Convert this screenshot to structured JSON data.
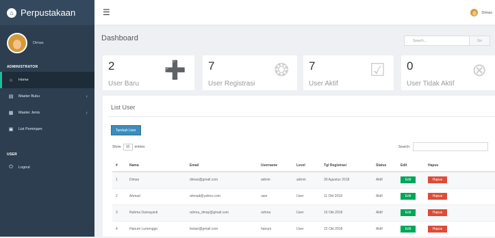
{
  "sidebar": {
    "brand": "Perpustakaan",
    "user_name": "Dimas",
    "section_admin": "ADMINISTRATOR",
    "section_user": "USER",
    "items": [
      {
        "label": "Home",
        "icon": "home-icon"
      },
      {
        "label": "Master Buku",
        "icon": "book-icon"
      },
      {
        "label": "Master Jenis",
        "icon": "list-icon"
      },
      {
        "label": "List Peminjam",
        "icon": "users-icon"
      },
      {
        "label": "Logout",
        "icon": "logout-icon"
      }
    ]
  },
  "topbar": {
    "menu_icon": "☰",
    "username": "Dimas"
  },
  "page": {
    "title": "Dashboard",
    "search_placeholder": "Search...",
    "search_button": "Go"
  },
  "stats": [
    {
      "value": "2",
      "label": "User Baru",
      "icon": "user-plus-icon",
      "glyph": "👤"
    },
    {
      "value": "7",
      "label": "User Registrasi",
      "icon": "users-icon",
      "glyph": "👥"
    },
    {
      "value": "7",
      "label": "User Aktif",
      "icon": "check-square-icon",
      "glyph": "☑"
    },
    {
      "value": "0",
      "label": "User Tidak Aktif",
      "icon": "times-circle-icon",
      "glyph": "⊗"
    }
  ],
  "panel": {
    "title": "List User",
    "add_button": "Tambah User",
    "show_prefix": "Show",
    "show_value": "10",
    "show_suffix": "entries",
    "search_label": "Search:"
  },
  "table": {
    "headers": [
      "#",
      "Nama",
      "Email",
      "Username",
      "Level",
      "Tgl Registrasi",
      "Status",
      "Edit",
      "Hapus"
    ],
    "rows": [
      {
        "no": "1",
        "nama": "Dimas",
        "email": "dimas@gmail.com",
        "username": "admin",
        "level": "admin",
        "tgl": "30 Agustus 2018",
        "status": "Aktif"
      },
      {
        "no": "2",
        "nama": "Ahmad",
        "email": "ahmad@yahoo.com",
        "username": "user",
        "level": "User",
        "tgl": "11 Okt 2018",
        "status": "Aktif"
      },
      {
        "no": "3",
        "nama": "Rahma Damayanti",
        "email": "rahma_dmay@gmail.com",
        "username": "rahma",
        "level": "User",
        "tgl": "15 Okt 2018",
        "status": "Aktif"
      },
      {
        "no": "4",
        "nama": "Hanum Lumenggo",
        "email": "lestari@gmail.com",
        "username": "hanum",
        "level": "User",
        "tgl": "22 Okt 2018",
        "status": "Aktif"
      }
    ],
    "edit_label": "Edit",
    "hapus_label": "Hapus"
  }
}
